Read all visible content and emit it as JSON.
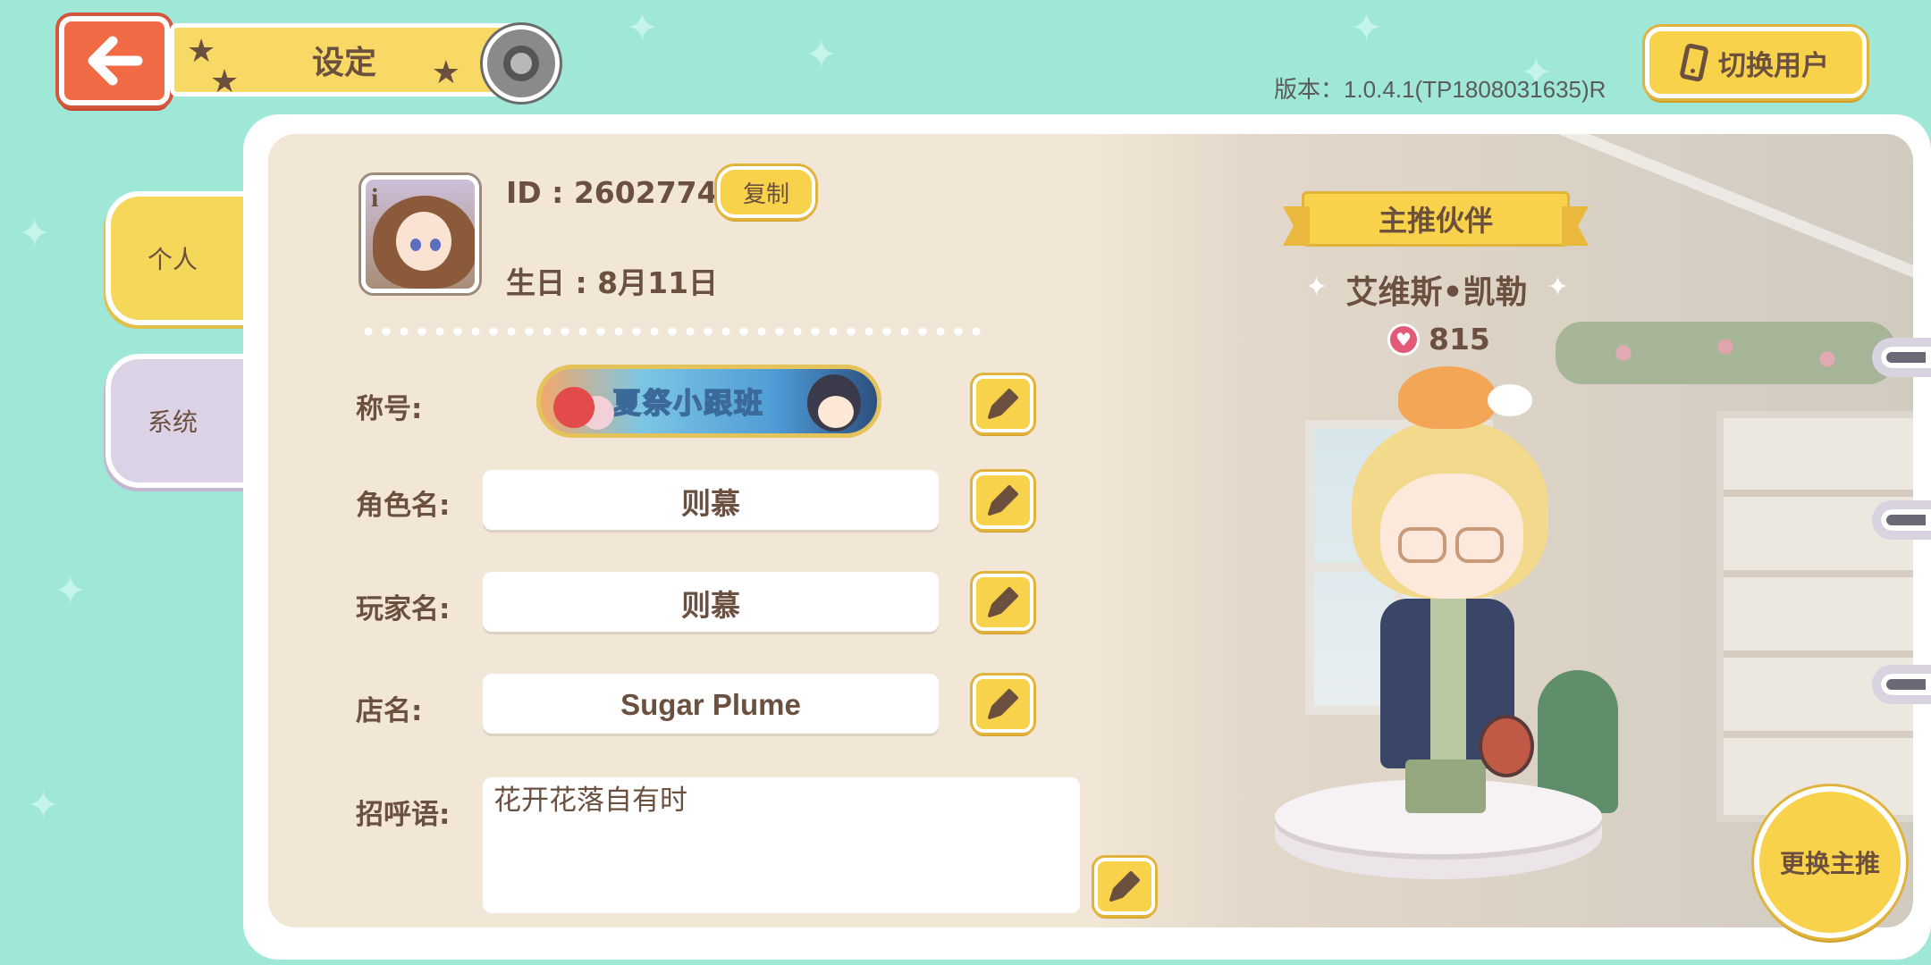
{
  "header": {
    "title": "设定",
    "version_text": "版本：1.0.4.1(TP1808031635)R",
    "switch_user_label": "切换用户"
  },
  "tabs": [
    {
      "label": "个人",
      "selected": true
    },
    {
      "label": "系统",
      "selected": false
    }
  ],
  "profile": {
    "id_text": "ID : 26027748",
    "copy_label": "复制",
    "birthday_text": "生日 : 8月11日",
    "title_label": "称号:",
    "title_badge_text": "夏祭小跟班",
    "role_name_label": "角色名:",
    "role_name_value": "则慕",
    "player_name_label": "玩家名:",
    "player_name_value": "则慕",
    "shop_name_label": "店名:",
    "shop_name_value": "Sugar Plume",
    "greeting_label": "招呼语:",
    "greeting_value": "花开花落自有时"
  },
  "partner": {
    "ribbon_label": "主推伙伴",
    "name": "艾维斯•凯勒",
    "affection": "815",
    "change_label": "更换主推"
  },
  "icons": {
    "back": "back-arrow-icon",
    "settings": "gear-icon",
    "phone": "phone-icon",
    "edit": "pencil-icon",
    "heart": "heart-icon",
    "info": "info-icon"
  },
  "colors": {
    "background": "#9fe8d8",
    "accent_yellow": "#f8d24a",
    "back_button": "#f06a45",
    "text_brown": "#6b4f3f",
    "panel_beige": "#f2e6d6"
  }
}
